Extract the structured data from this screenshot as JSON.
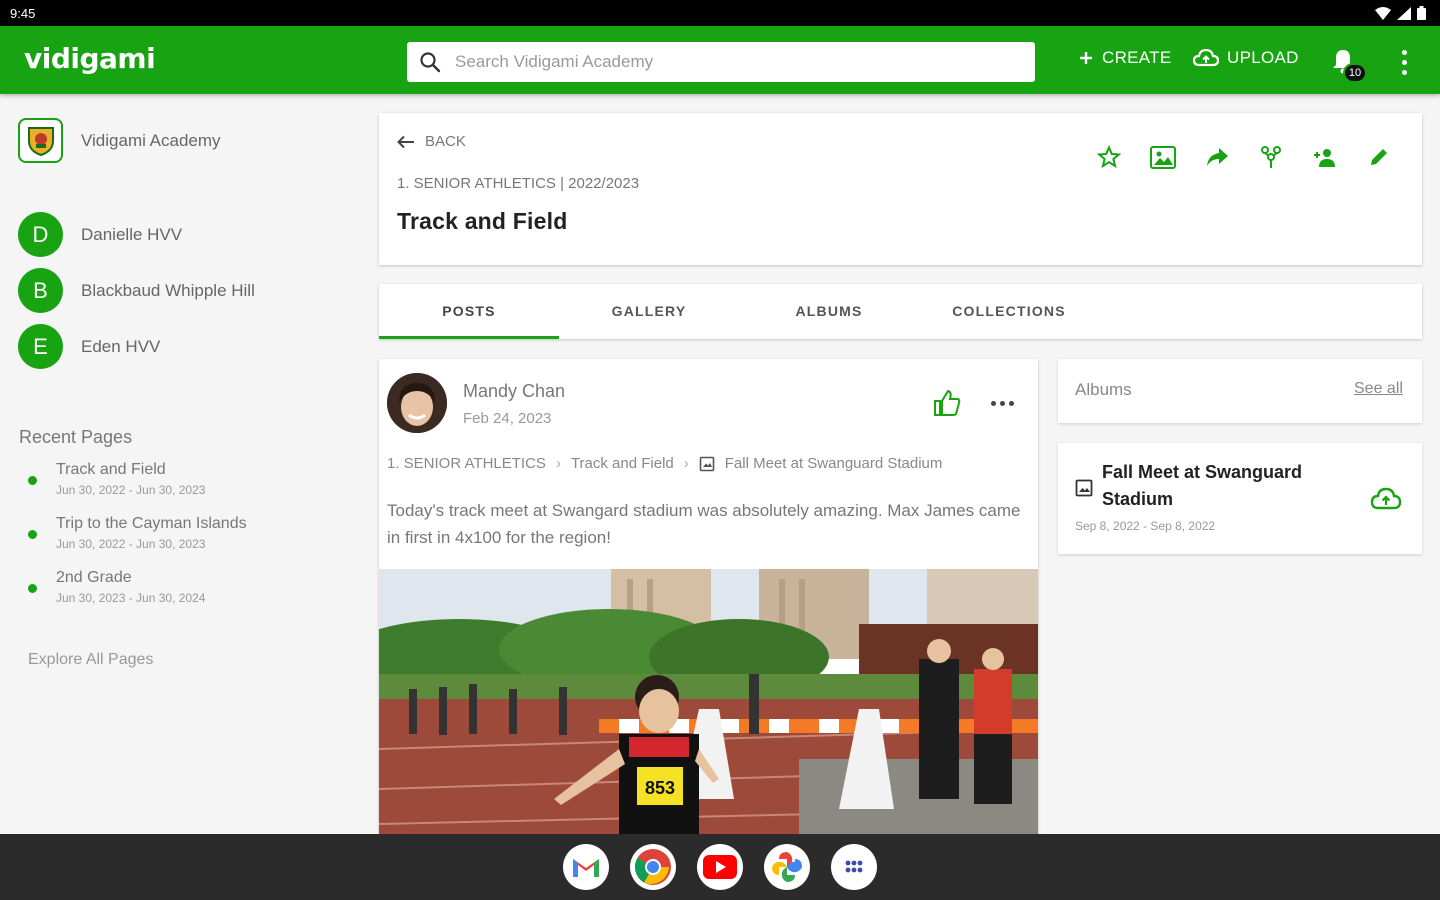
{
  "status_bar": {
    "time": "9:45"
  },
  "app": {
    "logo": "vidigami",
    "search_placeholder": "Search Vidigami Academy",
    "create_label": "CREATE",
    "upload_label": "UPLOAD",
    "notification_count": "10",
    "brand_color": "#17a312"
  },
  "sidebar": {
    "org_name": "Vidigami Academy",
    "members": [
      {
        "initial": "D",
        "name": "Danielle HVV"
      },
      {
        "initial": "B",
        "name": "Blackbaud Whipple Hill"
      },
      {
        "initial": "E",
        "name": "Eden HVV"
      }
    ],
    "recent_title": "Recent Pages",
    "recent_pages": [
      {
        "name": "Track and Field",
        "dates": "Jun 30, 2022 - Jun 30, 2023"
      },
      {
        "name": "Trip to the Cayman Islands",
        "dates": "Jun 30, 2022 - Jun 30, 2023"
      },
      {
        "name": "2nd Grade",
        "dates": "Jun 30, 2023 - Jun 30, 2024"
      }
    ],
    "explore_label": "Explore All Pages"
  },
  "header": {
    "back_label": "BACK",
    "breadcrumb": "1. SENIOR ATHLETICS | 2022/2023",
    "title": "Track and Field",
    "action_icons": [
      "star-icon",
      "photo-frame-icon",
      "share-icon",
      "group-icon",
      "add-person-icon",
      "edit-icon"
    ]
  },
  "tabs": [
    {
      "label": "POSTS",
      "active": true
    },
    {
      "label": "GALLERY",
      "active": false
    },
    {
      "label": "ALBUMS",
      "active": false
    },
    {
      "label": "COLLECTIONS",
      "active": false
    }
  ],
  "post": {
    "author": "Mandy Chan",
    "date": "Feb 24, 2023",
    "path": [
      "1. SENIOR ATHLETICS",
      "Track and Field",
      "Fall Meet at Swanguard Stadium"
    ],
    "text": "Today's track meet at Swangard stadium was absolutely amazing. Max James came in first in 4x100 for the region!",
    "bib_number": "853"
  },
  "albums_panel": {
    "title": "Albums",
    "see_all": "See all",
    "albums": [
      {
        "name": "Fall Meet at Swanguard Stadium",
        "dates": "Sep 8, 2022 - Sep 8, 2022"
      }
    ]
  },
  "dock": {
    "apps": [
      "gmail-icon",
      "chrome-icon",
      "youtube-icon",
      "photos-icon",
      "app-launcher-icon"
    ]
  }
}
